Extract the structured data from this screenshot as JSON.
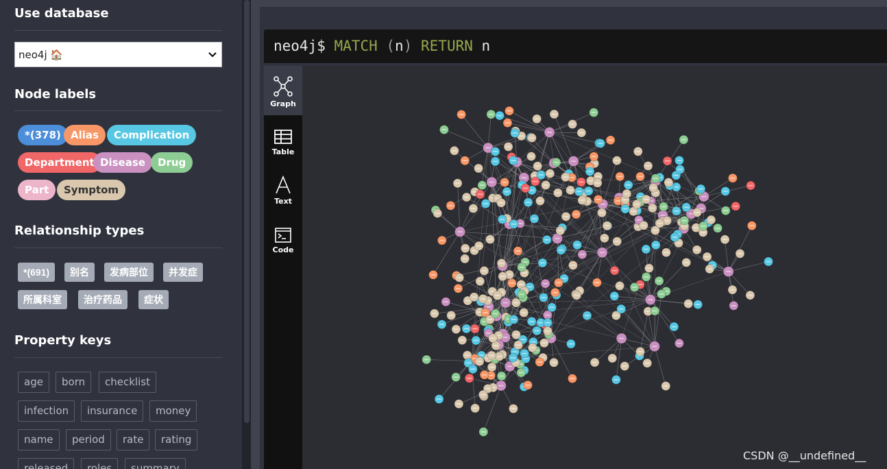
{
  "sidebar": {
    "use_database": {
      "title": "Use database",
      "selected": "neo4j 🏠"
    },
    "node_labels": {
      "title": "Node labels",
      "items": [
        {
          "label": "*(378)",
          "color": "#4c8eda"
        },
        {
          "label": "Alias",
          "color": "#f79767"
        },
        {
          "label": "Complication",
          "color": "#57c7e3"
        },
        {
          "label": "Department",
          "color": "#f16667"
        },
        {
          "label": "Disease",
          "color": "#c990c0"
        },
        {
          "label": "Drug",
          "color": "#8dcc93"
        },
        {
          "label": "Part",
          "color": "#ecb5c9"
        },
        {
          "label": "Symptom",
          "color": "#d9c8ae"
        }
      ]
    },
    "relationship_types": {
      "title": "Relationship types",
      "items": [
        "*(691)",
        "别名",
        "发病部位",
        "并发症",
        "所属科室",
        "治疗药品",
        "症状"
      ]
    },
    "property_keys": {
      "title": "Property keys",
      "items": [
        "age",
        "born",
        "checklist",
        "infection",
        "insurance",
        "money",
        "name",
        "period",
        "rate",
        "rating",
        "released",
        "roles",
        "summary"
      ]
    }
  },
  "editor": {
    "prompt": "neo4j$",
    "keyword_match": "MATCH",
    "open_paren": "(",
    "variable": "n",
    "close_paren": ")",
    "keyword_return": "RETURN",
    "return_var": "n"
  },
  "view_tabs": [
    {
      "label": "Graph",
      "icon": "graph-icon"
    },
    {
      "label": "Table",
      "icon": "table-icon"
    },
    {
      "label": "Text",
      "icon": "text-icon"
    },
    {
      "label": "Code",
      "icon": "code-icon"
    }
  ],
  "graph": {
    "palette": [
      "#d9c8ae",
      "#c990c0",
      "#57c7e3",
      "#f79767",
      "#8dcc93",
      "#f16667"
    ]
  },
  "watermark": "CSDN @__undefined__"
}
